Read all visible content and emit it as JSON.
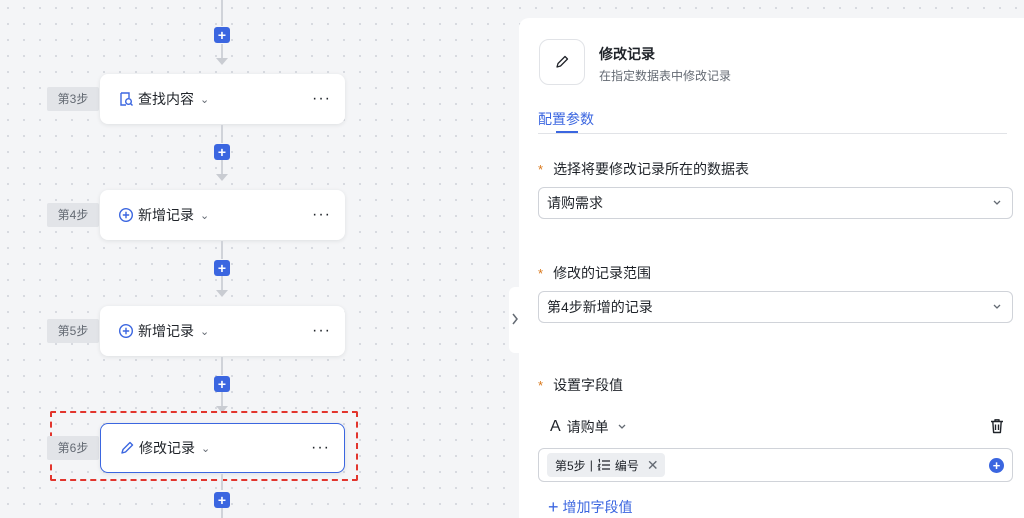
{
  "flow": {
    "add_symbol": "+",
    "more_symbol": "···",
    "chevron": "⌄",
    "steps": [
      {
        "tag": "第3步",
        "title": "查找内容",
        "icon": "search-record-icon"
      },
      {
        "tag": "第4步",
        "title": "新增记录",
        "icon": "plus-circle-icon"
      },
      {
        "tag": "第5步",
        "title": "新增记录",
        "icon": "plus-circle-icon"
      },
      {
        "tag": "第6步",
        "title": "修改记录",
        "icon": "pencil-icon",
        "selected": true
      }
    ]
  },
  "panel": {
    "title": "修改记录",
    "subtitle": "在指定数据表中修改记录",
    "tab": "配置参数",
    "required_mark": "*",
    "table_label": "选择将要修改记录所在的数据表",
    "table_value": "请购需求",
    "range_label": "修改的记录范围",
    "range_value": "第4步新增的记录",
    "fields_label": "设置字段值",
    "field_type_symbol": "A",
    "field_name": "请购单",
    "chip_step": "第5步",
    "chip_sep": "|",
    "chip_field": "编号",
    "chip_close": "✕",
    "add_field_plus": "+",
    "add_field_label": "增加字段值"
  },
  "colors": {
    "accent": "#3b66e0",
    "required": "#d9771a",
    "selection": "#e2352d"
  }
}
